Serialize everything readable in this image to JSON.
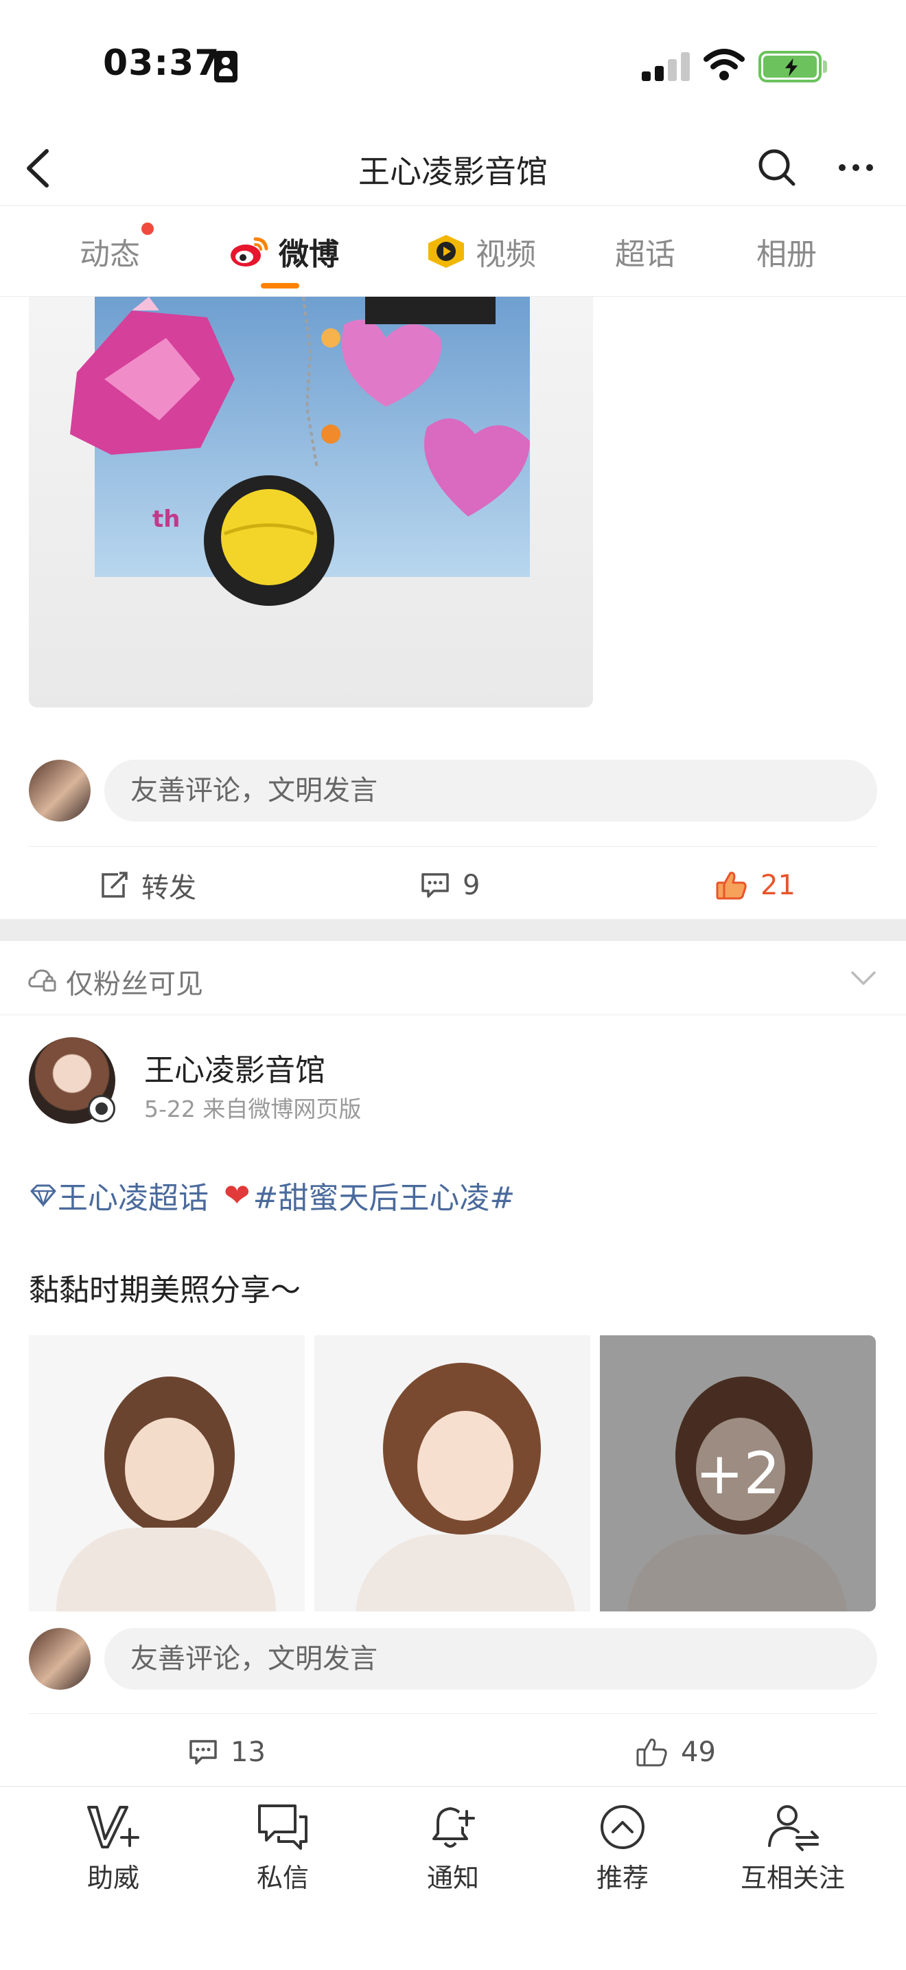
{
  "status_bar": {
    "time": "03:37"
  },
  "header": {
    "title": "王心凌影音馆"
  },
  "tabs": [
    {
      "label": "动态",
      "active": false,
      "has_dot": true
    },
    {
      "label": "微博",
      "active": true,
      "has_dot": false
    },
    {
      "label": "视频",
      "active": false,
      "has_dot": false
    },
    {
      "label": "超话",
      "active": false,
      "has_dot": false
    },
    {
      "label": "相册",
      "active": false,
      "has_dot": false
    }
  ],
  "post1": {
    "comment_placeholder": "友善评论，文明发言",
    "repost_label": "转发",
    "comments_count": "9",
    "likes_count": "21"
  },
  "post2": {
    "visibility": "仅粉丝可见",
    "author": "王心凌影音馆",
    "meta": "5-22  来自微博网页版",
    "topic_tag": "王心凌超话",
    "hashtag": "#甜蜜天后王心凌#",
    "text": "黏黏时期美照分享～",
    "extra_photos": "+2",
    "comment_placeholder": "友善评论，文明发言",
    "comments_count": "13",
    "likes_count": "49"
  },
  "bottom_bar": [
    {
      "label": "助威",
      "icon": "v-plus-icon"
    },
    {
      "label": "私信",
      "icon": "chat-bubbles-icon"
    },
    {
      "label": "通知",
      "icon": "bell-plus-icon"
    },
    {
      "label": "推荐",
      "icon": "up-circle-icon"
    },
    {
      "label": "互相关注",
      "icon": "mutual-follow-icon"
    }
  ],
  "colors": {
    "accent": "#ff8200",
    "like": "#e8552a",
    "link": "#4a6a9c",
    "dot": "#f04a3e"
  }
}
